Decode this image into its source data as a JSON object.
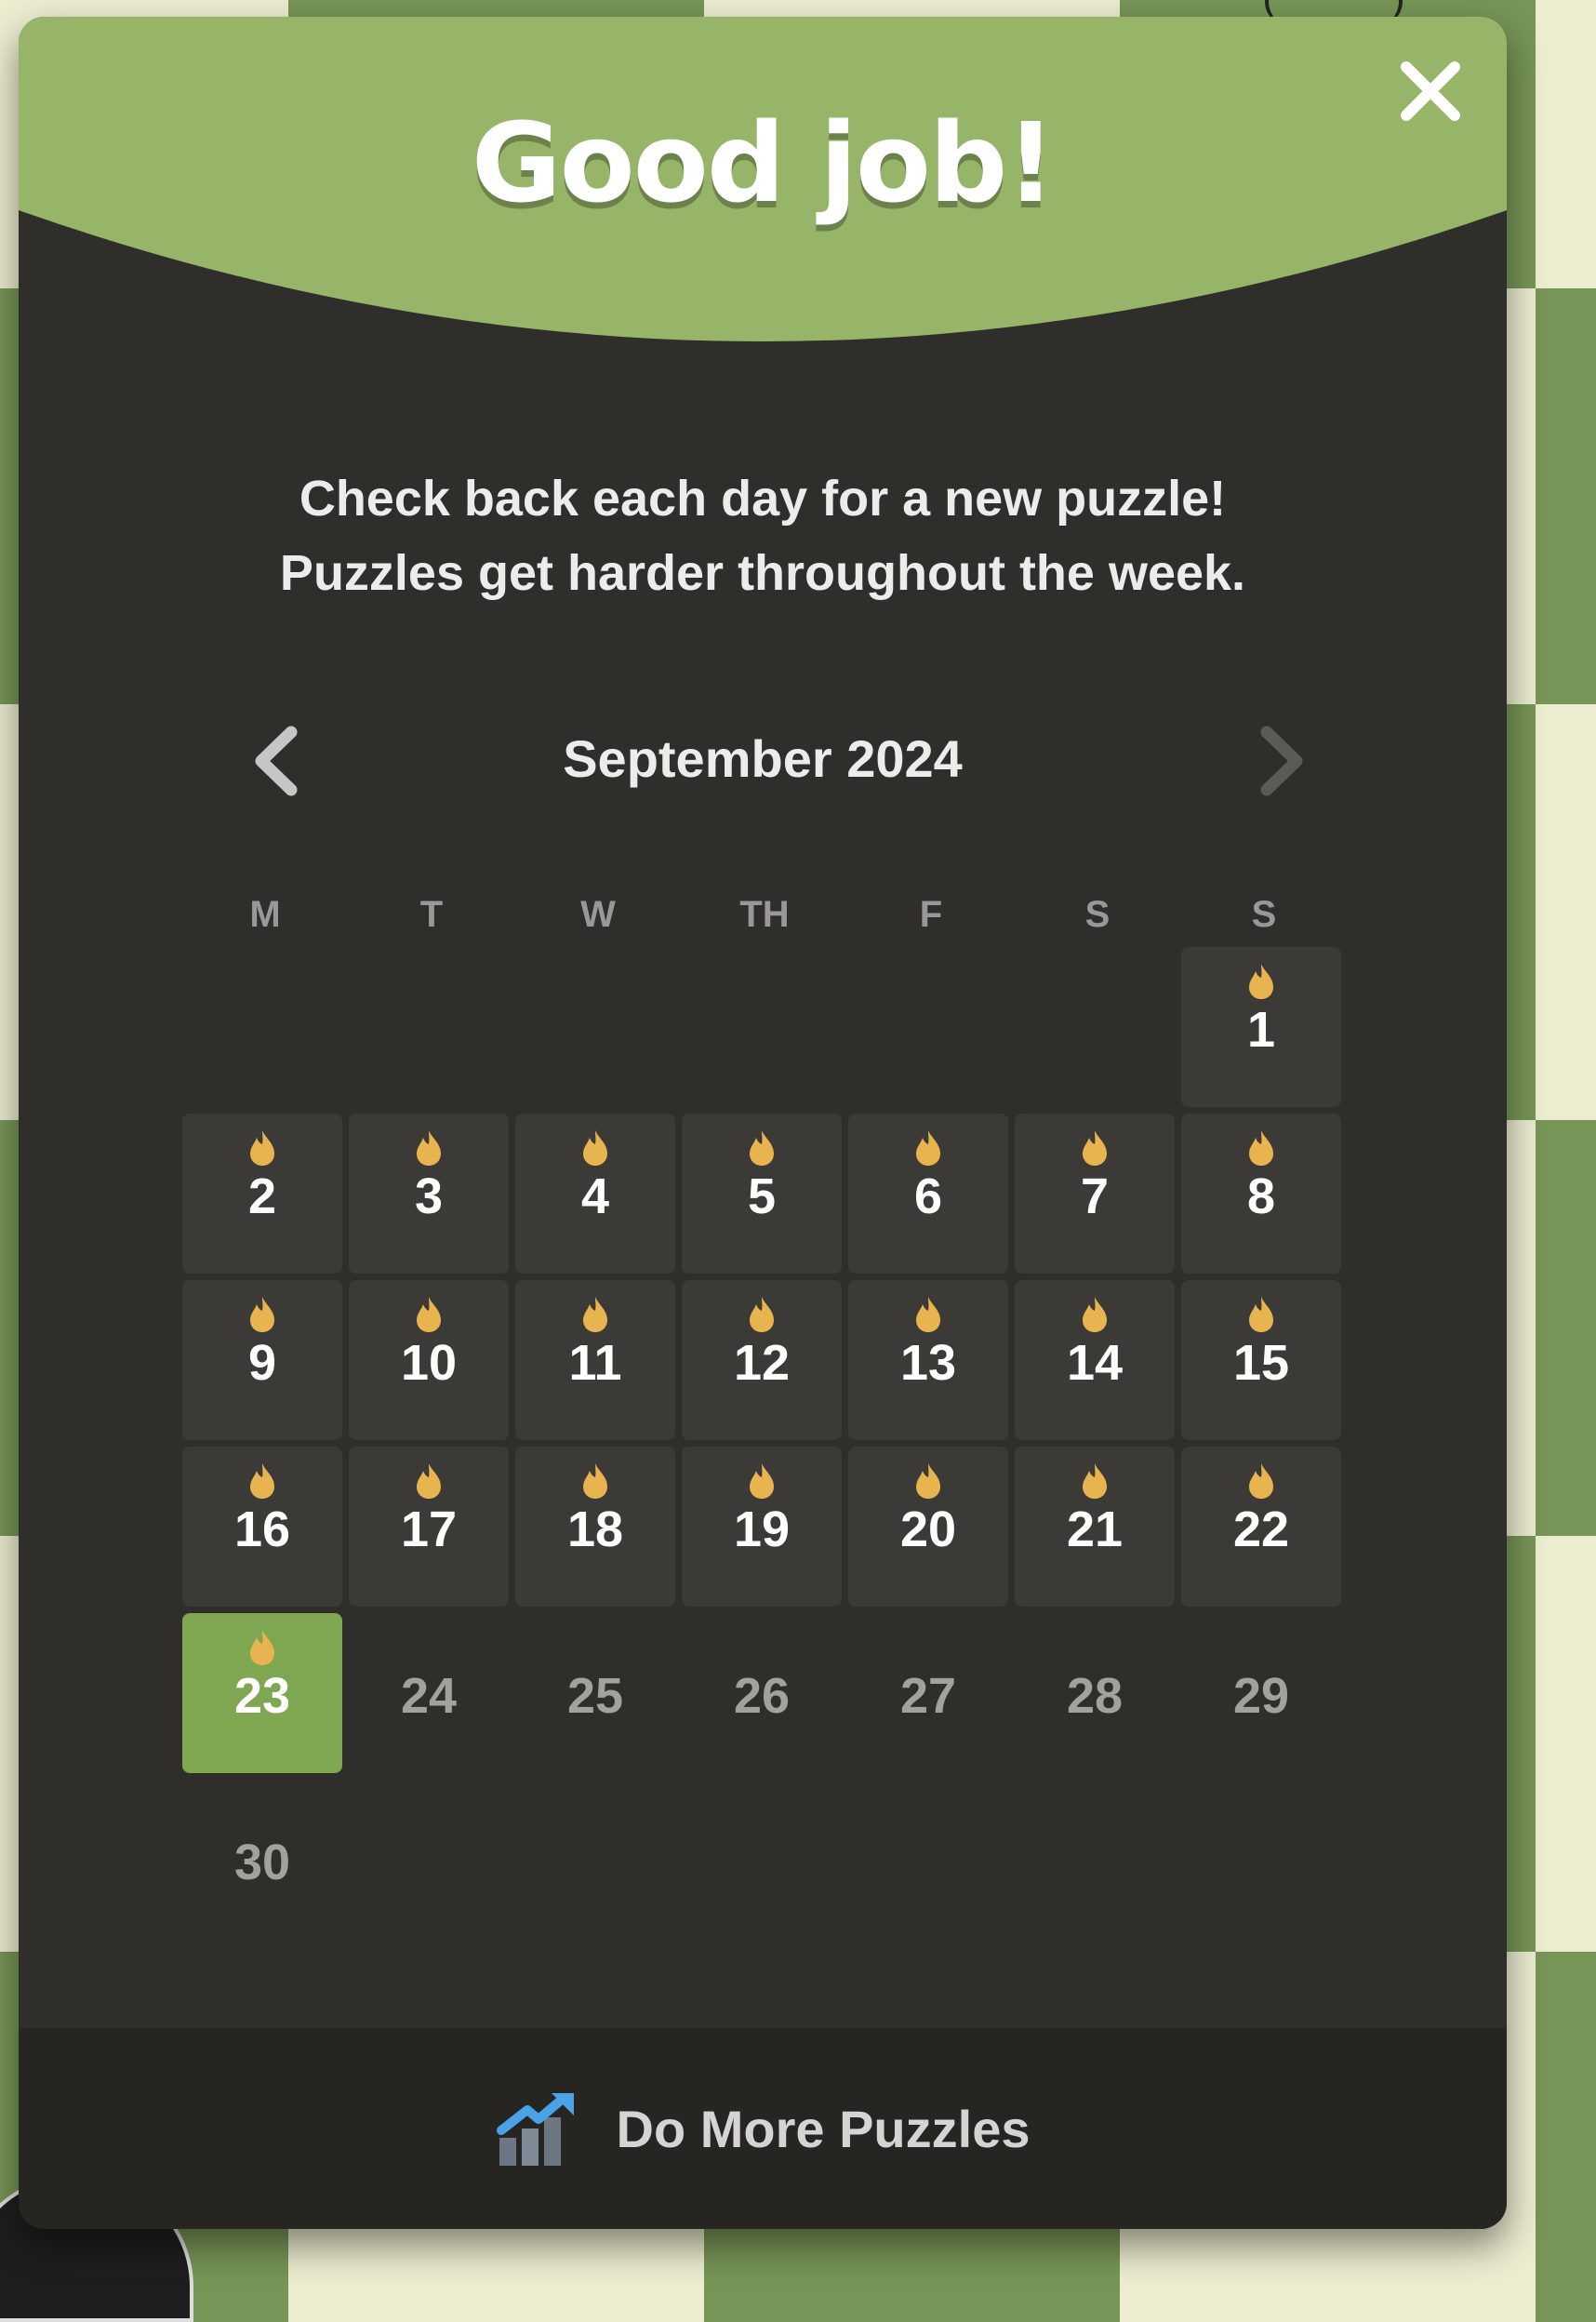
{
  "modal": {
    "title": "Good job!",
    "subtitle_line1": "Check back each day for a new puzzle!",
    "subtitle_line2": "Puzzles get harder throughout the week.",
    "close_icon": "close-icon",
    "colors": {
      "header": "#96b569",
      "panel": "#302e2b",
      "cell": "#3c3a37",
      "today": "#7fa650",
      "flame": "#e8b450"
    }
  },
  "calendar": {
    "month_label": "September 2024",
    "prev_icon": "chevron-left-icon",
    "next_icon": "chevron-right-icon",
    "weekdays": [
      "M",
      "T",
      "W",
      "TH",
      "F",
      "S",
      "S"
    ],
    "days": [
      {
        "day": "1",
        "state": "played"
      },
      {
        "day": "2",
        "state": "played"
      },
      {
        "day": "3",
        "state": "played"
      },
      {
        "day": "4",
        "state": "played"
      },
      {
        "day": "5",
        "state": "played"
      },
      {
        "day": "6",
        "state": "played"
      },
      {
        "day": "7",
        "state": "played"
      },
      {
        "day": "8",
        "state": "played"
      },
      {
        "day": "9",
        "state": "played"
      },
      {
        "day": "10",
        "state": "played"
      },
      {
        "day": "11",
        "state": "played"
      },
      {
        "day": "12",
        "state": "played"
      },
      {
        "day": "13",
        "state": "played"
      },
      {
        "day": "14",
        "state": "played"
      },
      {
        "day": "15",
        "state": "played"
      },
      {
        "day": "16",
        "state": "played"
      },
      {
        "day": "17",
        "state": "played"
      },
      {
        "day": "18",
        "state": "played"
      },
      {
        "day": "19",
        "state": "played"
      },
      {
        "day": "20",
        "state": "played"
      },
      {
        "day": "21",
        "state": "played"
      },
      {
        "day": "22",
        "state": "played"
      },
      {
        "day": "23",
        "state": "today"
      },
      {
        "day": "24",
        "state": "future"
      },
      {
        "day": "25",
        "state": "future"
      },
      {
        "day": "26",
        "state": "future"
      },
      {
        "day": "27",
        "state": "future"
      },
      {
        "day": "28",
        "state": "future"
      },
      {
        "day": "29",
        "state": "future"
      },
      {
        "day": "30",
        "state": "future"
      }
    ]
  },
  "footer": {
    "button_label": "Do More Puzzles",
    "icon": "chart-up-icon"
  }
}
